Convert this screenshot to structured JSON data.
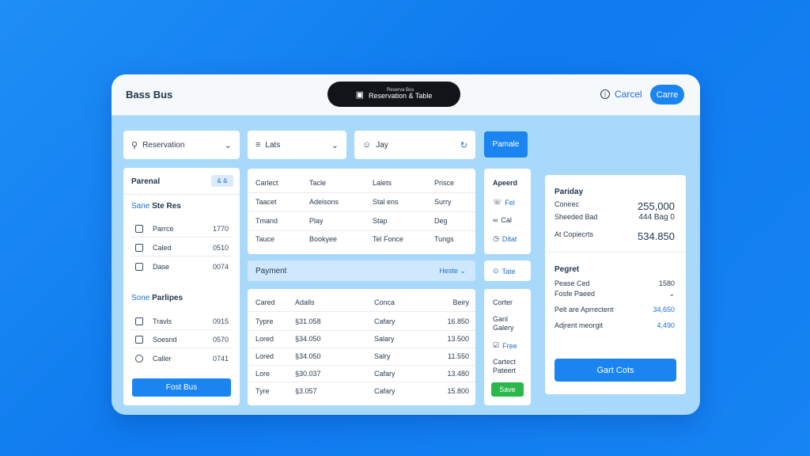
{
  "app": {
    "title": "Bass Bus",
    "pill_subtitle": "Reserva Bus",
    "pill_title": "Reservation & Table",
    "cancel_label": "Carcel",
    "top_button_label": "Carre"
  },
  "filters": {
    "reservation": "Reservation",
    "lists": "Lats",
    "name_value": "Jay",
    "search_button": "Pamale"
  },
  "left_panel": {
    "title": "Parenal",
    "badge": "& &",
    "section1_prefix": "Sane",
    "section1_title": "Ste Res",
    "section1_items": [
      {
        "label": "Parrce",
        "value": "1770"
      },
      {
        "label": "Caled",
        "value": "0510"
      },
      {
        "label": "Dase",
        "value": "0074"
      }
    ],
    "section2_prefix": "Sone",
    "section2_title": "Parlipes",
    "section2_items": [
      {
        "label": "Travls",
        "value": "0915"
      },
      {
        "label": "Soesnd",
        "value": "0570"
      },
      {
        "label": "Caller",
        "value": "0741"
      }
    ],
    "button": "Fost Bus"
  },
  "grid": {
    "rows": [
      [
        "Carlect",
        "Tacle",
        "Lalets",
        "Prisce"
      ],
      [
        "Taacet",
        "Adeisons",
        "Stal ens",
        "Surry"
      ],
      [
        "Tmand",
        "Play",
        "Stap",
        "Deg"
      ],
      [
        "Tauce",
        "Bookyee",
        "Tel Fonce",
        "Tungs"
      ]
    ]
  },
  "payment_bar": {
    "label": "Payment",
    "action": "Heste"
  },
  "table": {
    "headers": [
      "Cared",
      "Adalls",
      "Conca",
      "Beiry"
    ],
    "rows": [
      [
        "Typre",
        "§31.058",
        "Cafary",
        "16.850"
      ],
      [
        "Lored",
        "§34.050",
        "Salary",
        "13.500"
      ],
      [
        "Lored",
        "§34.050",
        "Salry",
        "11.550"
      ],
      [
        "Lore",
        "§30.037",
        "Cafary",
        "13.480"
      ],
      [
        "Tyre",
        "§3.057",
        "Cafary",
        "15.800"
      ]
    ]
  },
  "side_a": {
    "title": "Apeerd",
    "items": [
      {
        "icon": "phone-icon",
        "label": "Fel"
      },
      {
        "icon": "link-icon",
        "label": "Cal"
      },
      {
        "icon": "clock-icon",
        "label": "Ditat"
      }
    ]
  },
  "side_b": {
    "label": "Tate"
  },
  "side_c": {
    "title": "Corter",
    "line1": "Ganl",
    "line2": "Galery",
    "item_label": "Free",
    "line3": "Cartect",
    "line4": "Pateert",
    "button": "Save"
  },
  "summary": {
    "title": "Pariday",
    "rows": [
      {
        "label": "Conirec",
        "value": "255,000"
      },
      {
        "label": "Sheeded Bad",
        "value": "444 Bag 0"
      },
      {
        "label": "At Copiecrts",
        "value": "534.850"
      }
    ],
    "title2": "Pegret",
    "rows2": [
      {
        "label": "Pease Ced",
        "value": "1580"
      },
      {
        "label": "Fosfe Paeed",
        "value": "⌄"
      },
      {
        "label": "Pelt are Aprrectent",
        "value": "34,650"
      },
      {
        "label": "Adjrent meorgit",
        "value": "4,490"
      }
    ],
    "button": "Gart Cots"
  }
}
